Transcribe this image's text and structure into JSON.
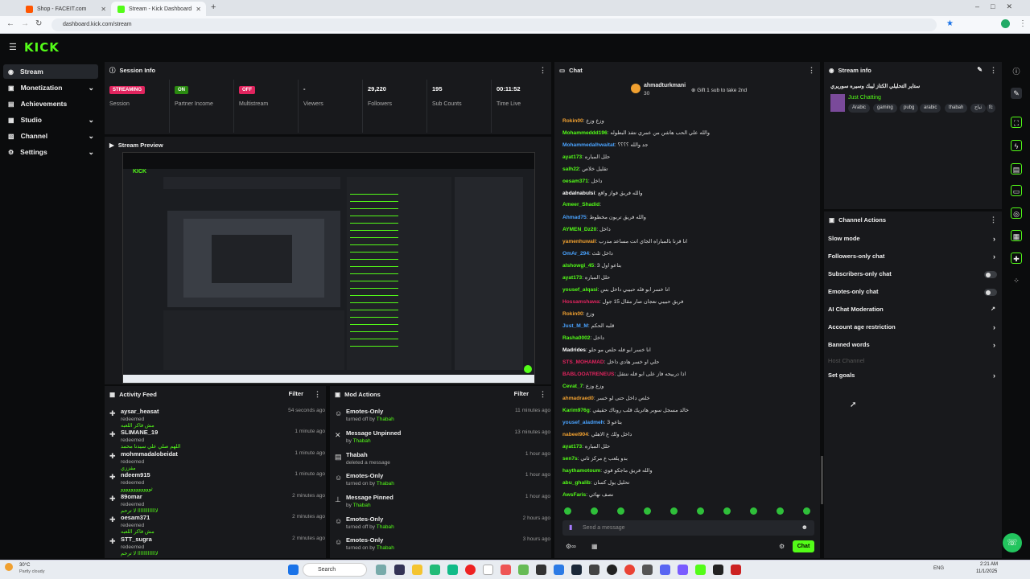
{
  "browser": {
    "tabs": [
      {
        "title": "Shop - FACEIT.com"
      },
      {
        "title": "Stream - Kick Dashboard"
      }
    ],
    "url": "dashboard.kick.com/stream"
  },
  "brand": {
    "logo": "KICK",
    "accent": "#53fc18"
  },
  "sidebar": {
    "items": [
      {
        "label": "Stream",
        "icon": "radio-icon"
      },
      {
        "label": "Monetization",
        "icon": "wallet-icon"
      },
      {
        "label": "Achievements",
        "icon": "trophy-icon"
      },
      {
        "label": "Studio",
        "icon": "studio-icon"
      },
      {
        "label": "Channel",
        "icon": "channel-icon"
      },
      {
        "label": "Settings",
        "icon": "gear-icon"
      }
    ]
  },
  "session": {
    "title": "Session Info",
    "stats": [
      {
        "value": "STREAMING",
        "label": "Session",
        "kind": "badge",
        "color": "#e0245e"
      },
      {
        "value": "ON",
        "label": "Partner Income",
        "kind": "badge",
        "color": "#53fc18"
      },
      {
        "value": "OFF",
        "label": "Multistream",
        "kind": "badge",
        "color": "#e0245e"
      },
      {
        "value": "-",
        "label": "Viewers"
      },
      {
        "value": "29,220",
        "label": "Followers"
      },
      {
        "value": "195",
        "label": "Sub Counts"
      },
      {
        "value": "00:11:52",
        "label": "Time Live"
      }
    ]
  },
  "preview": {
    "title": "Stream Preview"
  },
  "activity": {
    "title": "Activity Feed",
    "filter": "Filter",
    "items": [
      {
        "name": "aysar_heasat",
        "text": "redeemed",
        "reward": "مش فاكر اللعبه",
        "time": "54 seconds ago"
      },
      {
        "name": "SLIMANE_19",
        "text": "redeemed",
        "reward": "اللهم صلي علي سيدنا محمد",
        "time": "1 minute ago"
      },
      {
        "name": "mohmmadalobeidat",
        "text": "redeemed",
        "reward": "مقززي",
        "time": "1 minute ago"
      },
      {
        "name": "ndeem915",
        "text": "redeemed",
        "reward": "ثوووووووووووو",
        "time": "1 minute ago"
      },
      {
        "name": "89omar",
        "text": "redeemed",
        "reward": "لااااااااااااا لا ترحم",
        "time": "2 minutes ago"
      },
      {
        "name": "oesam371",
        "text": "redeemed",
        "reward": "مش فاكر اللعبه",
        "time": "2 minutes ago"
      },
      {
        "name": "STT_sugra",
        "text": "redeemed",
        "reward": "لااااااااااااا لا ترحم",
        "time": "2 minutes ago"
      }
    ]
  },
  "mod": {
    "title": "Mod Actions",
    "filter": "Filter",
    "items": [
      {
        "action": "Emotes-Only",
        "detail": "turned off by",
        "by": "Thabah",
        "time": "11 minutes ago"
      },
      {
        "action": "Message Unpinned",
        "detail": "by",
        "by": "Thabah",
        "time": "13 minutes ago"
      },
      {
        "action": "Thabah",
        "detail": "deleted a message",
        "by": "",
        "time": "1 hour ago"
      },
      {
        "action": "Emotes-Only",
        "detail": "turned on by",
        "by": "Thabah",
        "time": "1 hour ago"
      },
      {
        "action": "Message Pinned",
        "detail": "by",
        "by": "Thabah",
        "time": "1 hour ago"
      },
      {
        "action": "Emotes-Only",
        "detail": "turned off by",
        "by": "Thabah",
        "time": "2 hours ago"
      },
      {
        "action": "Emotes-Only",
        "detail": "turned on by",
        "by": "Thabah",
        "time": "3 hours ago"
      }
    ]
  },
  "chat": {
    "title": "Chat",
    "pinned_user": "ahmadturkmani",
    "pinned_count": "30",
    "gift_text": "Gift 1 sub to take 2nd",
    "placeholder": "Send a message",
    "send": "Chat",
    "messages": [
      {
        "user": "Rokin00",
        "color": "#f0a030",
        "text": "وزع وزع"
      },
      {
        "user": "Mohammeddd196",
        "color": "#53fc18",
        "text": "والله علي الحب هاشن من عمري نتفذ البطوله"
      },
      {
        "user": "Mohammedalhwaitat",
        "color": "#4aa3ff",
        "text": "جد والله ؟؟؟؟"
      },
      {
        "user": "ayat173",
        "color": "#53fc18",
        "text": "حلل المباره"
      },
      {
        "user": "salh22",
        "color": "#53fc18",
        "text": "تقليل خلاص"
      },
      {
        "user": "oesam371",
        "color": "#53fc18",
        "text": "داخل"
      },
      {
        "user": "abdalnabulsi",
        "color": "#ffffff",
        "text": "والله فريق فواز واقع"
      },
      {
        "user": "Ameer_Shadid",
        "color": "#53fc18",
        "text": ""
      },
      {
        "user": "Ahmad75",
        "color": "#4aa3ff",
        "text": "والله فريق تربون مخطوط"
      },
      {
        "user": "AYMEN_Dz20",
        "color": "#53fc18",
        "text": "داخل"
      },
      {
        "user": "yamenhuwail",
        "color": "#f0a030",
        "text": "انا فزنا بالمباراه الجاي انت مساعد مدرب"
      },
      {
        "user": "OmAr_294",
        "color": "#4aa3ff",
        "text": "داخل ثلث"
      },
      {
        "user": "alshowgi_45",
        "color": "#53fc18",
        "text": "بتاعو اول 3"
      },
      {
        "user": "ayat173",
        "color": "#53fc18",
        "text": "حلل المباره"
      },
      {
        "user": "yousef_alqasi",
        "color": "#53fc18",
        "text": "انا خسر ابو فله حبيبي داخل بس"
      },
      {
        "user": "Hossamshawa",
        "color": "#e0245e",
        "text": "فريق حبيبي نعجان صار مقال 15 جول"
      },
      {
        "user": "Rokin00",
        "color": "#f0a030",
        "text": "وزع"
      },
      {
        "user": "Just_M_M",
        "color": "#4aa3ff",
        "text": "قلبه الحكم"
      },
      {
        "user": "Rasha0002",
        "color": "#53fc18",
        "text": "داخل"
      },
      {
        "user": "Madrides",
        "color": "#ffffff",
        "text": "انا خسر ابو فله حلص مو حلو"
      },
      {
        "user": "STS_MOHAMAD",
        "color": "#e0245e",
        "text": "حلي او خسر هادي داخل"
      },
      {
        "user": "BABLOOATRENEUS",
        "color": "#e0245e",
        "text": "اذا دربيحه فاز على ابو فله ننتقل"
      },
      {
        "user": "Cevat_7",
        "color": "#53fc18",
        "text": "وزع وزع"
      },
      {
        "user": "ahmadraed0",
        "color": "#f0a030",
        "text": "خلص داخل حتى لو خسر"
      },
      {
        "user": "Karim976g",
        "color": "#53fc18",
        "text": "خالد مسجل سوبر هاتريك قلب روناك حقيقي"
      },
      {
        "user": "yousef_aladmeh",
        "color": "#4aa3ff",
        "text": "بتاعو 3"
      },
      {
        "user": "nabeel904",
        "color": "#f0a030",
        "text": "داخل ولك ع الاهلي"
      },
      {
        "user": "ayat173",
        "color": "#53fc18",
        "text": "حلل المباره"
      },
      {
        "user": "sen7s",
        "color": "#53fc18",
        "text": "بدو يلعب ع مركز ثاني"
      },
      {
        "user": "haythamotoum",
        "color": "#53fc18",
        "text": "والله فريق ماجكو قوي"
      },
      {
        "user": "abu_ghalib",
        "color": "#53fc18",
        "text": "تحليل يول كسان"
      },
      {
        "user": "AwsFaris",
        "color": "#53fc18",
        "text": "نصف نهائي"
      }
    ]
  },
  "stream_info": {
    "title": "Stream info",
    "stream_title": "ستاير التحليلي الكتاز ليبك وسيره سوريري",
    "category": "Just Chatting",
    "tags": [
      "Arabic",
      "gaming",
      "pubg",
      "arabic",
      "thabah",
      "ثباح",
      "fc"
    ]
  },
  "channel_actions": {
    "title": "Channel Actions",
    "items": [
      {
        "label": "Slow mode",
        "control": "chevron"
      },
      {
        "label": "Followers-only chat",
        "control": "chevron"
      },
      {
        "label": "Subscribers-only chat",
        "control": "toggle",
        "state": "off"
      },
      {
        "label": "Emotes-only chat",
        "control": "toggle",
        "state": "off"
      },
      {
        "label": "AI Chat Moderation",
        "control": "external"
      },
      {
        "label": "Account age restriction",
        "control": "chevron"
      },
      {
        "label": "Banned words",
        "control": "chevron"
      },
      {
        "label": "Host Channel",
        "control": "none"
      },
      {
        "label": "Set goals",
        "control": "chevron"
      }
    ]
  },
  "taskbar": {
    "weather_temp": "30°C",
    "weather_text": "Partly cloudy",
    "search": "Search",
    "lang": "ENG",
    "time": "2:21 AM",
    "date": "11/1/2025"
  }
}
